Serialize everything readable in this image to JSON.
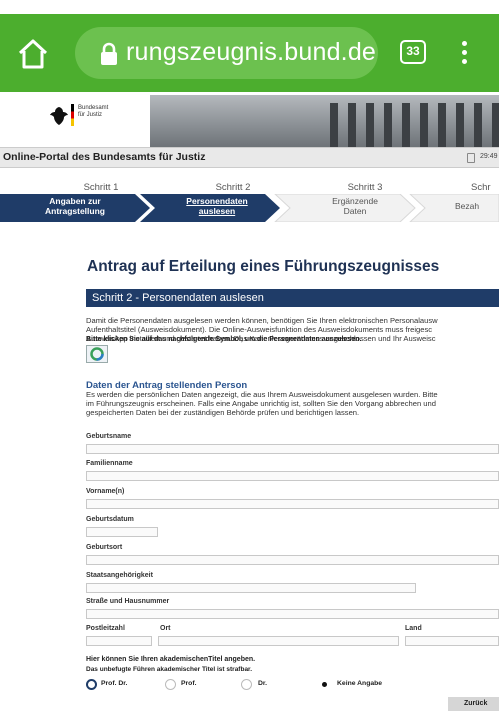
{
  "browser": {
    "url": "rungszeugnis.bund.de",
    "tab_count": "33"
  },
  "header": {
    "logo_text_line1": "Bundesamt",
    "logo_text_line2": "für Justiz",
    "portal_title": "Online-Portal des Bundesamts für Justiz",
    "timer": "29:49"
  },
  "steps": [
    {
      "label": "Schritt 1",
      "text_line1": "Angaben zur",
      "text_line2": "Antragstellung",
      "state": "done"
    },
    {
      "label": "Schritt 2",
      "text_line1": "Personendaten",
      "text_line2": "auslesen",
      "state": "current"
    },
    {
      "label": "Schritt 3",
      "text_line1": "Ergänzende",
      "text_line2": "Daten",
      "state": "todo"
    },
    {
      "label": "Schr",
      "text_line1": "Bezah",
      "text_line2": "",
      "state": "todo"
    }
  ],
  "main": {
    "heading": "Antrag auf Erteilung eines Führungszeugnisses",
    "section_title": "Schritt 2 - Personendaten auslesen",
    "intro_line1": "Damit die Personendaten ausgelesen werden können, benötigen Sie Ihren elektronischen Personalausw",
    "intro_line2": "Aufenthaltstitel (Ausweisdokument). Die Online-Ausweisfunktion des Ausweisdokuments muss freigesc",
    "intro_line3": "AusweisApp installiert und gestartet haben. Das Kartenlesegerät muss angeschlossen und Ihr Ausweisc",
    "click_hint": "Bitte klicken Sie auf das nachfolgende Symbol, um die Personendaten auszulesen.",
    "person_heading": "Daten der Antrag stellenden Person",
    "desc_line1": "Es werden die persönlichen Daten angezeigt, die aus Ihrem Ausweisdokument ausgelesen wurden. Bitte",
    "desc_line2": "im Führungszeugnis erscheinen. Falls eine Angabe unrichtig ist, sollten Sie den Vorgang abbrechen und",
    "desc_line3": "gespeicherten Daten bei der zuständigen Behörde prüfen und berichtigen lassen."
  },
  "fields": {
    "geburtsname": "Geburtsname",
    "familienname": "Familienname",
    "vornamen": "Vorname(n)",
    "geburtsdatum": "Geburtsdatum",
    "geburtsort": "Geburtsort",
    "staatsangehoerigkeit": "Staatsangehörigkeit",
    "strasse": "Straße und Hausnummer",
    "plz": "Postleitzahl",
    "ort": "Ort",
    "land": "Land"
  },
  "titles": {
    "hint": "Hier können Sie Ihren akademischenTitel angeben.",
    "warning": "Das unbefugte Führen akademischer Titel ist strafbar.",
    "options": [
      "Prof. Dr.",
      "Prof.",
      "Dr.",
      "Keine Angabe"
    ],
    "selected": "Keine Angabe"
  },
  "actions": {
    "back": "Zurück"
  },
  "colors": {
    "browser_green": "#4cae2e",
    "navy": "#1f3c68",
    "heading_blue": "#1f3254",
    "link_blue": "#2b5590"
  }
}
